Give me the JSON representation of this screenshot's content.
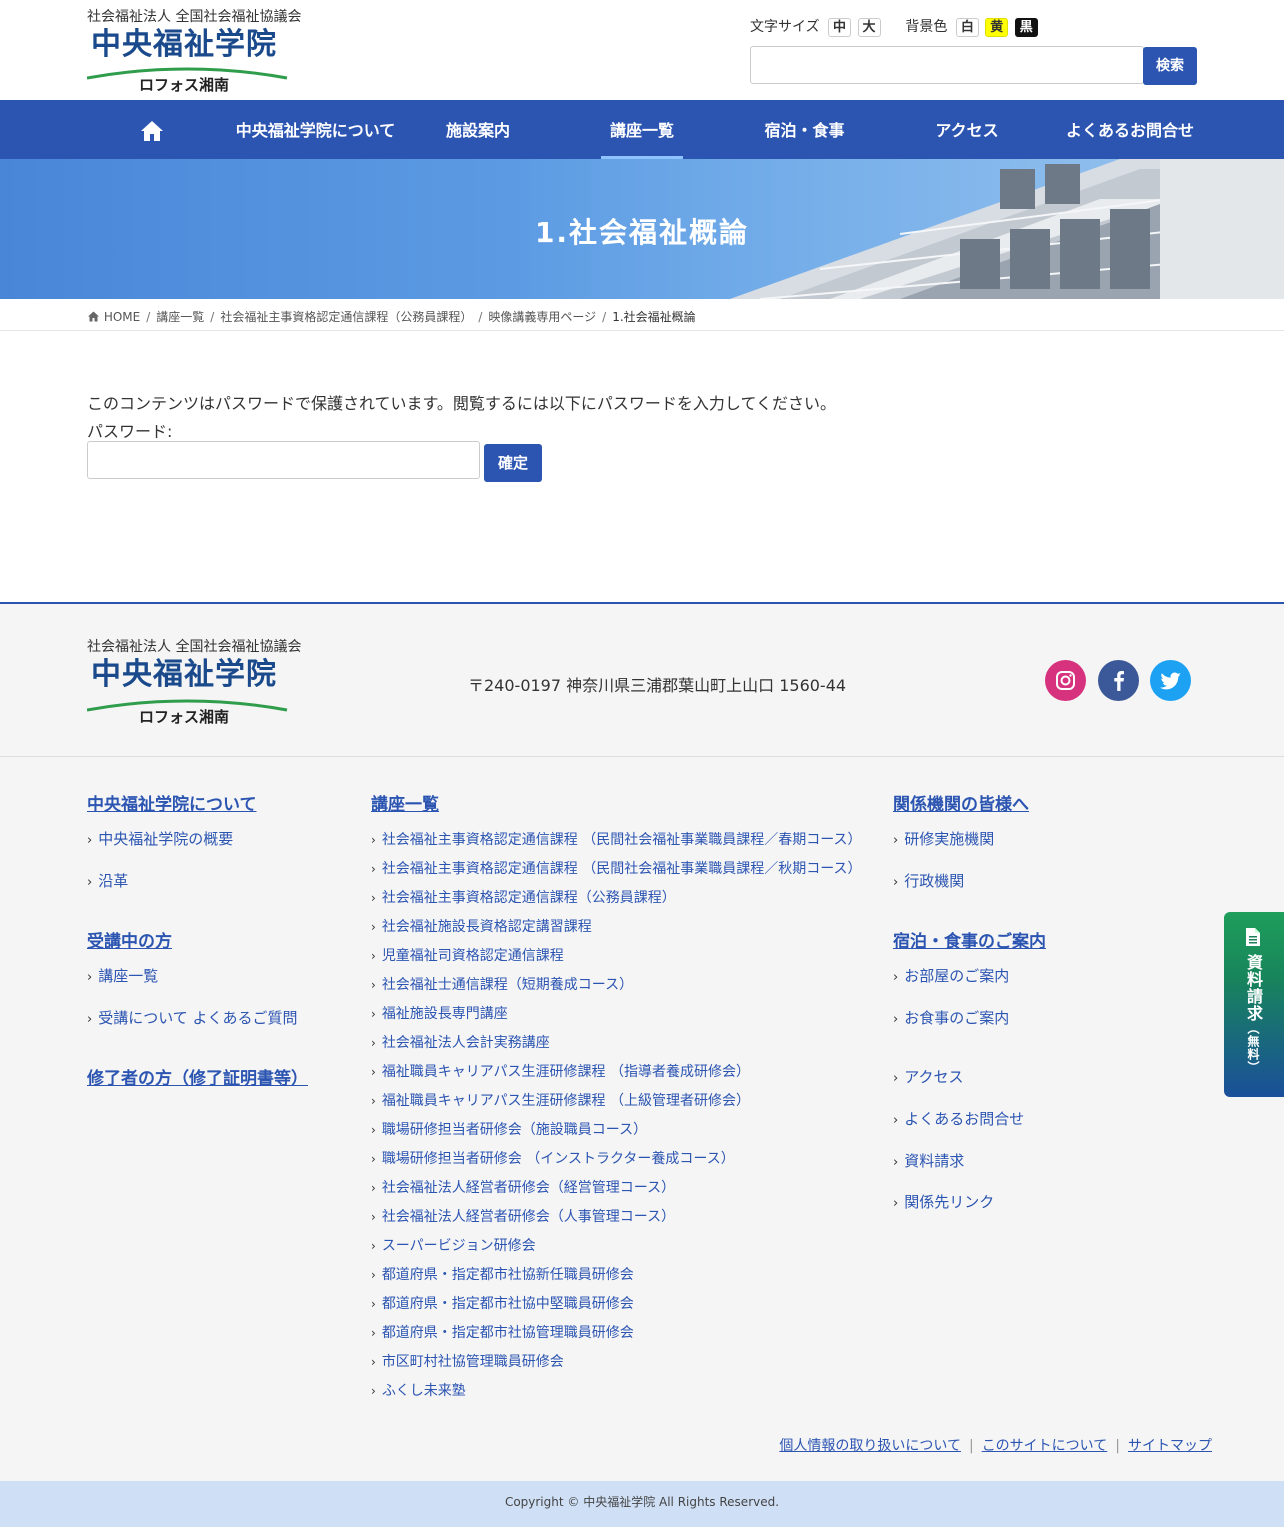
{
  "header": {
    "org": "社会福祉法人 全国社会福祉協議会",
    "logo_main": "中央福祉学院",
    "logo_sub": "ロフォス湘南",
    "font_size_label": "文字サイズ",
    "font_sizes": [
      "中",
      "大"
    ],
    "bg_label": "背景色",
    "bg_colors": [
      "白",
      "黄",
      "黒"
    ],
    "search_button": "検索",
    "search_value": ""
  },
  "nav": {
    "home_icon": "home-icon",
    "items": [
      "中央福祉学院について",
      "施設案内",
      "講座一覧",
      "宿泊・食事",
      "アクセス",
      "よくあるお問合せ"
    ],
    "active_index": 2
  },
  "hero": {
    "title": "1.社会福祉概論"
  },
  "breadcrumb": {
    "items": [
      "HOME",
      "講座一覧",
      "社会福祉主事資格認定通信課程（公務員課程）",
      "映像講義専用ページ",
      "1.社会福祉概論"
    ]
  },
  "main": {
    "message": "このコンテンツはパスワードで保護されています。閲覧するには以下にパスワードを入力してください。",
    "password_label": "パスワード:",
    "password_value": "",
    "submit_label": "確定"
  },
  "footer": {
    "org": "社会福祉法人 全国社会福祉協議会",
    "logo_main": "中央福祉学院",
    "logo_sub": "ロフォス湘南",
    "address": "〒240-0197 神奈川県三浦郡葉山町上山口 1560-44",
    "social": [
      {
        "name": "instagram-icon",
        "color": "#d6327d"
      },
      {
        "name": "facebook-icon",
        "color": "#3b5998"
      },
      {
        "name": "twitter-icon",
        "color": "#1da1f2"
      }
    ],
    "col1": {
      "about_heading": "中央福祉学院について",
      "about_links": [
        "中央福祉学院の概要",
        "沿革"
      ],
      "students_heading": "受講中の方",
      "students_links": [
        "講座一覧",
        "受講について よくあるご質問"
      ],
      "graduates_heading": "修了者の方（修了証明書等）"
    },
    "col2": {
      "heading": "講座一覧",
      "courses": [
        "社会福祉主事資格認定通信課程 （民間社会福祉事業職員課程／春期コース）",
        "社会福祉主事資格認定通信課程 （民間社会福祉事業職員課程／秋期コース）",
        "社会福祉主事資格認定通信課程（公務員課程）",
        "社会福祉施設長資格認定講習課程",
        "児童福祉司資格認定通信課程",
        "社会福祉士通信課程（短期養成コース）",
        "福祉施設長専門講座",
        "社会福祉法人会計実務講座",
        "福祉職員キャリアパス生涯研修課程 （指導者養成研修会）",
        "福祉職員キャリアパス生涯研修課程 （上級管理者研修会）",
        "職場研修担当者研修会（施設職員コース）",
        "職場研修担当者研修会 （インストラクター養成コース）",
        "社会福祉法人経営者研修会（経営管理コース）",
        "社会福祉法人経営者研修会（人事管理コース）",
        "スーパービジョン研修会",
        "都道府県・指定都市社協新任職員研修会",
        "都道府県・指定都市社協中堅職員研修会",
        "都道府県・指定都市社協管理職員研修会",
        "市区町村社協管理職員研修会",
        "ふくし未来塾"
      ]
    },
    "col3": {
      "related_heading": "関係機関の皆様へ",
      "related_links": [
        "研修実施機関",
        "行政機関"
      ],
      "stay_heading": "宿泊・食事のご案内",
      "stay_links": [
        "お部屋のご案内",
        "お食事のご案内"
      ],
      "misc_links": [
        "アクセス",
        "よくあるお問合せ",
        "資料請求",
        "関係先リンク"
      ]
    },
    "bottom_links": [
      "個人情報の取り扱いについて",
      "このサイトについて",
      "サイトマップ"
    ],
    "copyright": "Copyright © 中央福祉学院 All Rights Reserved."
  },
  "side_tab": {
    "label": "資料請求",
    "note": "（無料）"
  },
  "colors": {
    "brand": "#2c55b2",
    "logo": "#1b4a8c",
    "copyright_bg": "#cfe0f6"
  }
}
